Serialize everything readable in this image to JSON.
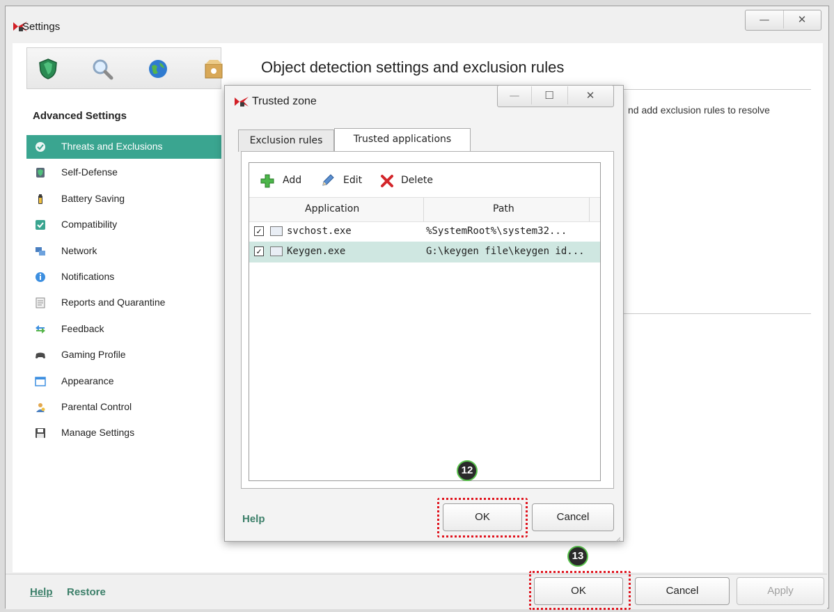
{
  "main_window": {
    "title": "Settings",
    "minimize_glyph": "—",
    "close_glyph": "✕"
  },
  "toolbar_icons": [
    "shield-icon",
    "search-icon",
    "globe-icon",
    "box-icon"
  ],
  "sidebar": {
    "section_title": "Advanced Settings",
    "items": [
      {
        "label": "Threats and Exclusions",
        "icon": "checkmark-icon",
        "active": true
      },
      {
        "label": "Self-Defense",
        "icon": "self-defense-icon"
      },
      {
        "label": "Battery Saving",
        "icon": "battery-icon"
      },
      {
        "label": "Compatibility",
        "icon": "compatibility-icon"
      },
      {
        "label": "Network",
        "icon": "network-icon"
      },
      {
        "label": "Notifications",
        "icon": "notification-icon"
      },
      {
        "label": "Reports and Quarantine",
        "icon": "reports-icon"
      },
      {
        "label": "Feedback",
        "icon": "feedback-icon"
      },
      {
        "label": "Gaming Profile",
        "icon": "gamepad-icon"
      },
      {
        "label": "Appearance",
        "icon": "appearance-icon"
      },
      {
        "label": "Parental Control",
        "icon": "parental-control-icon"
      },
      {
        "label": "Manage Settings",
        "icon": "save-icon"
      }
    ]
  },
  "right_pane": {
    "heading": "Object detection settings and exclusion rules",
    "description_fragment": "nd add exclusion rules to resolve"
  },
  "bottom_bar": {
    "help": "Help",
    "restore": "Restore",
    "ok": "OK",
    "cancel": "Cancel",
    "apply": "Apply",
    "step_badge": "13"
  },
  "dialog": {
    "title": "Trusted zone",
    "minimize_glyph": "—",
    "maximize_glyph": "☐",
    "close_glyph": "✕",
    "tabs": [
      {
        "label": "Exclusion rules",
        "active": false
      },
      {
        "label": "Trusted applications",
        "active": true
      }
    ],
    "toolbar": {
      "add": "Add",
      "edit": "Edit",
      "delete": "Delete"
    },
    "columns": [
      "Application",
      "Path"
    ],
    "rows": [
      {
        "checked": true,
        "application": "svchost.exe",
        "path": "%SystemRoot%\\system32...",
        "selected": false
      },
      {
        "checked": true,
        "application": "Keygen.exe",
        "path": "G:\\keygen file\\keygen id...",
        "selected": true
      }
    ],
    "help": "Help",
    "ok": "OK",
    "cancel": "Cancel",
    "step_badge": "12"
  },
  "colors": {
    "accent": "#3aa590",
    "highlight_box": "#e0131d",
    "link": "#3c7f69",
    "selected_row": "#cfe7e1"
  }
}
